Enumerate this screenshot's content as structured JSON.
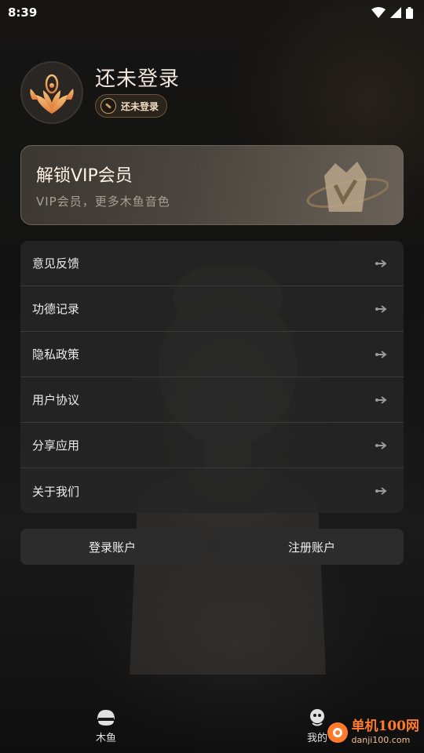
{
  "status_bar": {
    "time": "8:39"
  },
  "profile": {
    "name": "还未登录",
    "badge_label": "还未登录"
  },
  "vip": {
    "title": "解锁VIP会员",
    "subtitle": "VIP会员，更多木鱼音色"
  },
  "menu": {
    "items": [
      {
        "label": "意见反馈"
      },
      {
        "label": "功德记录"
      },
      {
        "label": "隐私政策"
      },
      {
        "label": "用户协议"
      },
      {
        "label": "分享应用"
      },
      {
        "label": "关于我们"
      }
    ]
  },
  "buttons": {
    "login": "登录账户",
    "register": "注册账户"
  },
  "tabs": [
    {
      "label": "木鱼",
      "icon": "woodfish-icon"
    },
    {
      "label": "我的",
      "icon": "profile-icon"
    }
  ],
  "watermark": {
    "brand": "单机100网",
    "domain": "danji100.com"
  },
  "colors": {
    "accent": "#e8a060",
    "card": "#262626"
  }
}
